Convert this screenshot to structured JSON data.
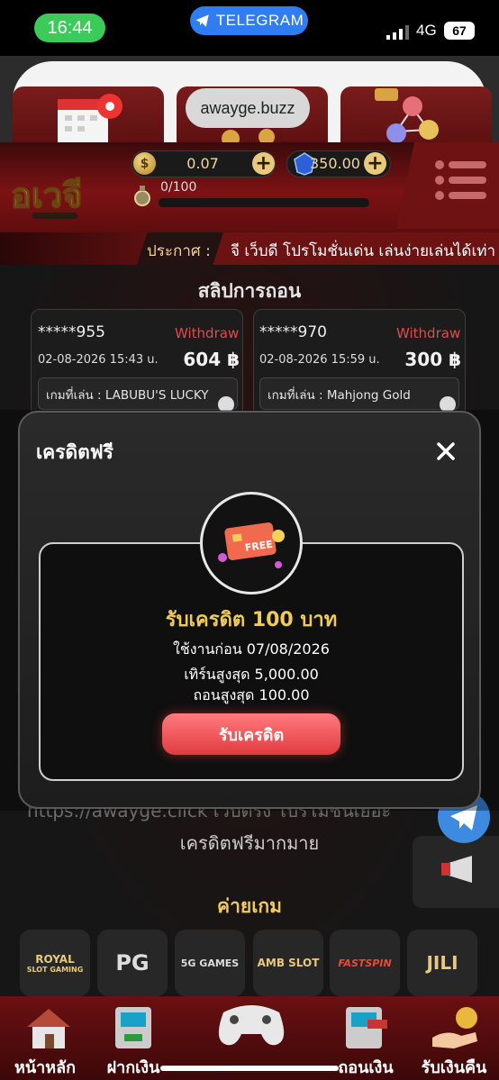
{
  "status_bar": {
    "time": "16:44",
    "app_pill": "TELEGRAM",
    "network": "4G",
    "battery": "67"
  },
  "browser": {
    "url": "awayge.buzz"
  },
  "header": {
    "coin_symbol": "$",
    "coin_balance": "0.07",
    "gem_balance": "350.00",
    "level_progress": "0/100",
    "level_fraction": 0.0
  },
  "announcement": {
    "label": "ประกาศ :",
    "text": "จี เว็บดี โปรโมชั่นเด่น เล่นง่ายเล่นได้เท่า"
  },
  "withdrawals": {
    "title": "สลิปการถอน",
    "cards": [
      {
        "user": "*****955",
        "tag": "Withdraw",
        "date": "02-08-2026 15:43 u.",
        "amount": "604 ฿",
        "game": "เกมที่เล่น : LABUBU'S LUCKY"
      },
      {
        "user": "*****970",
        "tag": "Withdraw",
        "date": "02-08-2026 15:59 u.",
        "amount": "300 ฿",
        "game": "เกมที่เล่น : Mahjong Gold"
      }
    ]
  },
  "modal": {
    "title": "เครดิตฟรี",
    "badge_text": "FREE",
    "reward_title": "รับเครดิต 100 บาท",
    "expiry": "ใช้งานก่อน 07/08/2026",
    "max_turnover": "เทิร์นสูงสุด 5,000.00",
    "max_withdraw": "ถอนสูงสุด 100.00",
    "claim_button": "รับเครดิต"
  },
  "site_info": {
    "url_text": "https://awayge.click เว็บตรง โปรโมชั่นเยอะ",
    "text": "เครดิตฟรีมากมาย"
  },
  "providers": {
    "title": "ค่ายเกม",
    "items": [
      "ROYAL",
      "PG",
      "5G GAMES",
      "AMB SLOT",
      "FASTSPIN",
      "JILI"
    ],
    "royal_sub": "SLOT GAMING"
  },
  "bottom_nav": {
    "items": [
      "หน้าหลัก",
      "ฝากเงิน",
      "",
      "ถอนเงิน",
      "รับเงินคืน"
    ]
  },
  "colors": {
    "accent_red": "#7c1214",
    "gold": "#f1cb5a",
    "claim_button": "#e13b40"
  }
}
